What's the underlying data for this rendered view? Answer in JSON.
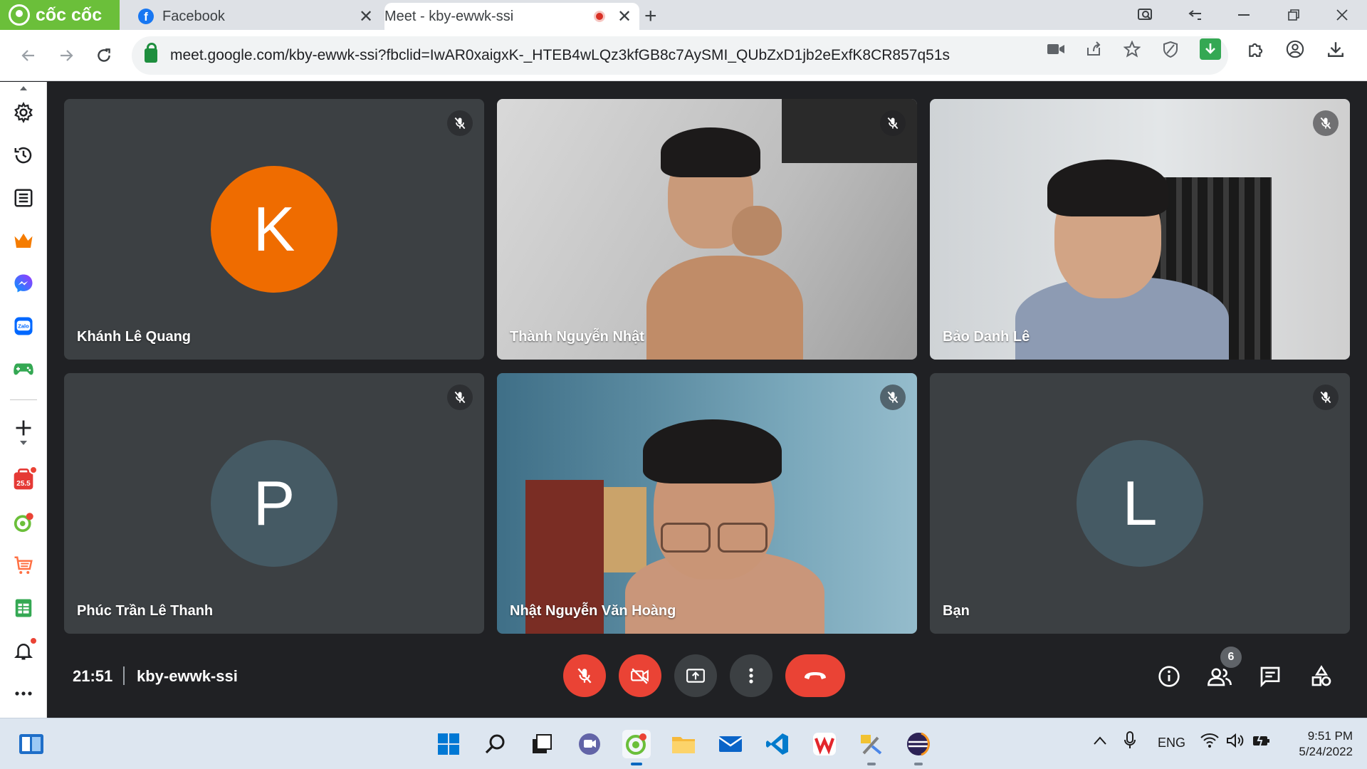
{
  "browser": {
    "brand": "cốc cốc",
    "tabs": [
      {
        "title": "Facebook",
        "icon": "facebook-icon"
      },
      {
        "title": "Meet - kby-ewwk-ssi",
        "icon": "google-meet-icon"
      }
    ],
    "url": "meet.google.com/kby-ewwk-ssi?fbclid=IwAR0xaigxK-_HTEB4wLQz3kfGB8c7AySMI_QUbZxD1jb2eExfK8CR857q51s"
  },
  "meeting": {
    "time": "21:51",
    "code": "kby-ewwk-ssi",
    "participant_count": "6",
    "participants": [
      {
        "name": "Khánh Lê Quang",
        "initial": "K",
        "avatar_color": "#ef6c00",
        "video": false,
        "muted": true
      },
      {
        "name": "Thành Nguyễn Nhật",
        "initial": "",
        "avatar_color": "",
        "video": true,
        "muted": true
      },
      {
        "name": "Bảo Danh Lê",
        "initial": "",
        "avatar_color": "",
        "video": true,
        "muted": true
      },
      {
        "name": "Phúc Trần Lê Thanh",
        "initial": "P",
        "avatar_color": "#455a64",
        "video": false,
        "muted": true
      },
      {
        "name": "Nhật Nguyễn Văn Hoàng",
        "initial": "",
        "avatar_color": "",
        "video": true,
        "muted": true
      },
      {
        "name": "Bạn",
        "initial": "L",
        "avatar_color": "#455a64",
        "video": false,
        "muted": true
      }
    ]
  },
  "taskbar": {
    "language": "ENG",
    "time": "9:51 PM",
    "date": "5/24/2022"
  },
  "sidebar_badge": "25.5",
  "colors": {
    "meet_bg": "#202124",
    "tile_bg": "#3c4043",
    "danger": "#ea4335",
    "coccoc_green": "#6bbf3a"
  }
}
